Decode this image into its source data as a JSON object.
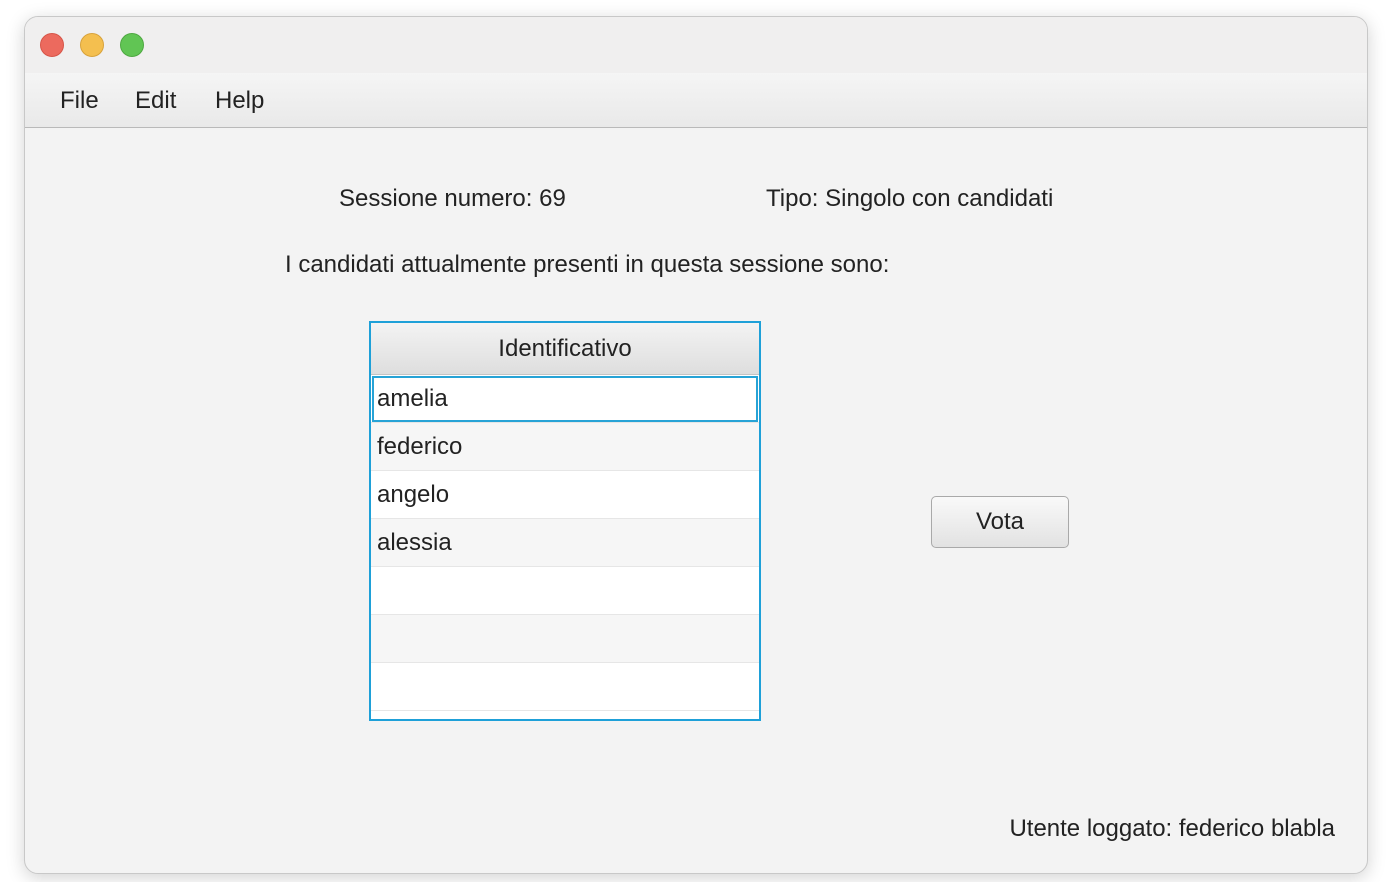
{
  "window": {
    "controls": {
      "close": "close-button",
      "minimize": "minimize-button",
      "maximize": "maximize-button"
    }
  },
  "menubar": {
    "items": [
      {
        "label": "File"
      },
      {
        "label": "Edit"
      },
      {
        "label": "Help"
      }
    ]
  },
  "session": {
    "number_label": "Sessione numero: 69",
    "type_label": "Tipo: Singolo con candidati"
  },
  "candidates_intro": "I candidati attualmente presenti in questa sessione sono:",
  "table": {
    "header": "Identificativo",
    "rows": [
      "amelia",
      "federico",
      "angelo",
      "alessia",
      "",
      "",
      ""
    ],
    "selected_index": 0
  },
  "vote_button_label": "Vota",
  "status": {
    "logged_user": "Utente loggato: federico blabla"
  },
  "colors": {
    "accent": "#1ea0d8",
    "background": "#f3f3f3",
    "close": "#ec6a5e",
    "minimize": "#f4bf4f",
    "maximize": "#61c554"
  }
}
